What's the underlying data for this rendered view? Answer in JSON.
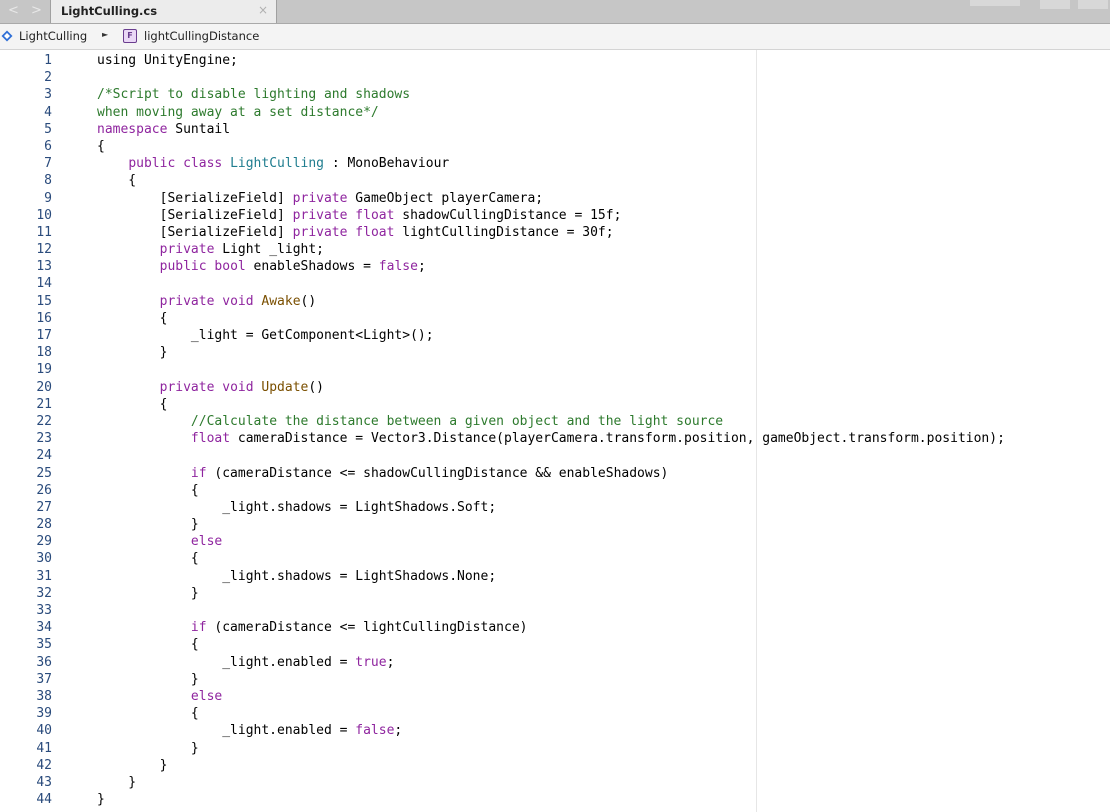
{
  "tab": {
    "label": "LightCulling.cs",
    "close_glyph": "×"
  },
  "breadcrumb": {
    "class_label": "LightCulling",
    "field_label": "lightCullingDistance",
    "field_icon_letter": "F",
    "separator": "►"
  },
  "colors": {
    "keyword": "#8f259f",
    "type": "#1f7d8f",
    "comment": "#2d7a2d",
    "method": "#7a4f00",
    "line_number": "#2a4b7c"
  },
  "code_lines": [
    [
      {
        "t": "using UnityEngine;"
      }
    ],
    [],
    [
      {
        "t": "/*Script to disable lighting and shadows",
        "c": "c"
      }
    ],
    [
      {
        "t": "when moving away at a set distance*/",
        "c": "c"
      }
    ],
    [
      {
        "t": "namespace",
        "c": "k"
      },
      {
        "t": " Suntail"
      }
    ],
    [
      {
        "t": "{"
      }
    ],
    [
      {
        "t": "    "
      },
      {
        "t": "public",
        "c": "k"
      },
      {
        "t": " "
      },
      {
        "t": "class",
        "c": "k"
      },
      {
        "t": " "
      },
      {
        "t": "LightCulling",
        "c": "t"
      },
      {
        "t": " : MonoBehaviour"
      }
    ],
    [
      {
        "t": "    {"
      }
    ],
    [
      {
        "t": "        [SerializeField] "
      },
      {
        "t": "private",
        "c": "k"
      },
      {
        "t": " GameObject playerCamera;"
      }
    ],
    [
      {
        "t": "        [SerializeField] "
      },
      {
        "t": "private",
        "c": "k"
      },
      {
        "t": " "
      },
      {
        "t": "float",
        "c": "k"
      },
      {
        "t": " shadowCullingDistance = 15f;"
      }
    ],
    [
      {
        "t": "        [SerializeField] "
      },
      {
        "t": "private",
        "c": "k"
      },
      {
        "t": " "
      },
      {
        "t": "float",
        "c": "k"
      },
      {
        "t": " lightCullingDistance = 30f;"
      }
    ],
    [
      {
        "t": "        "
      },
      {
        "t": "private",
        "c": "k"
      },
      {
        "t": " Light _light;"
      }
    ],
    [
      {
        "t": "        "
      },
      {
        "t": "public",
        "c": "k"
      },
      {
        "t": " "
      },
      {
        "t": "bool",
        "c": "k"
      },
      {
        "t": " enableShadows = "
      },
      {
        "t": "false",
        "c": "k"
      },
      {
        "t": ";"
      }
    ],
    [],
    [
      {
        "t": "        "
      },
      {
        "t": "private",
        "c": "k"
      },
      {
        "t": " "
      },
      {
        "t": "void",
        "c": "k"
      },
      {
        "t": " "
      },
      {
        "t": "Awake",
        "c": "f"
      },
      {
        "t": "()"
      }
    ],
    [
      {
        "t": "        {"
      }
    ],
    [
      {
        "t": "            _light = GetComponent<Light>();"
      }
    ],
    [
      {
        "t": "        }"
      }
    ],
    [],
    [
      {
        "t": "        "
      },
      {
        "t": "private",
        "c": "k"
      },
      {
        "t": " "
      },
      {
        "t": "void",
        "c": "k"
      },
      {
        "t": " "
      },
      {
        "t": "Update",
        "c": "f"
      },
      {
        "t": "()"
      }
    ],
    [
      {
        "t": "        {"
      }
    ],
    [
      {
        "t": "            "
      },
      {
        "t": "//Calculate the distance between a given object and the light source",
        "c": "c"
      }
    ],
    [
      {
        "t": "            "
      },
      {
        "t": "float",
        "c": "k"
      },
      {
        "t": " cameraDistance = Vector3.Distance(playerCamera.transform.position, gameObject.transform.position);"
      }
    ],
    [],
    [
      {
        "t": "            "
      },
      {
        "t": "if",
        "c": "k"
      },
      {
        "t": " (cameraDistance <= shadowCullingDistance && enableShadows)"
      }
    ],
    [
      {
        "t": "            {"
      }
    ],
    [
      {
        "t": "                _light.shadows = LightShadows.Soft;"
      }
    ],
    [
      {
        "t": "            }"
      }
    ],
    [
      {
        "t": "            "
      },
      {
        "t": "else",
        "c": "k"
      }
    ],
    [
      {
        "t": "            {"
      }
    ],
    [
      {
        "t": "                _light.shadows = LightShadows.None;"
      }
    ],
    [
      {
        "t": "            }"
      }
    ],
    [],
    [
      {
        "t": "            "
      },
      {
        "t": "if",
        "c": "k"
      },
      {
        "t": " (cameraDistance <= lightCullingDistance)"
      }
    ],
    [
      {
        "t": "            {"
      }
    ],
    [
      {
        "t": "                _light.enabled = "
      },
      {
        "t": "true",
        "c": "k"
      },
      {
        "t": ";"
      }
    ],
    [
      {
        "t": "            }"
      }
    ],
    [
      {
        "t": "            "
      },
      {
        "t": "else",
        "c": "k"
      }
    ],
    [
      {
        "t": "            {"
      }
    ],
    [
      {
        "t": "                _light.enabled = "
      },
      {
        "t": "false",
        "c": "k"
      },
      {
        "t": ";"
      }
    ],
    [
      {
        "t": "            }"
      }
    ],
    [
      {
        "t": "        }"
      }
    ],
    [
      {
        "t": "    }"
      }
    ],
    [
      {
        "t": "}"
      }
    ]
  ]
}
